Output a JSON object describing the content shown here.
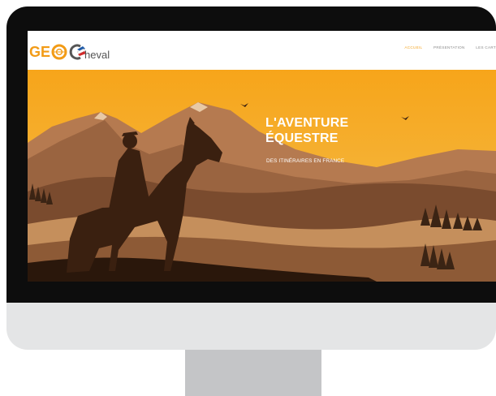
{
  "logo": {
    "text_geo": "GE",
    "text_cheval": "heval"
  },
  "nav": {
    "items": [
      "ACCUEIL",
      "PRÉSENTATION",
      "LES CART"
    ],
    "active_index": 0
  },
  "hero": {
    "title_line1": "L'AVENTURE",
    "title_line2": "ÉQUESTRE",
    "subtitle": "DES ITINÉRAIRES EN FRANCE"
  },
  "colors": {
    "accent": "#f5a623",
    "sky": "#f6a61c",
    "bezel": "#0d0d0d",
    "chin": "#e4e5e6",
    "stand": "#c4c5c7"
  }
}
